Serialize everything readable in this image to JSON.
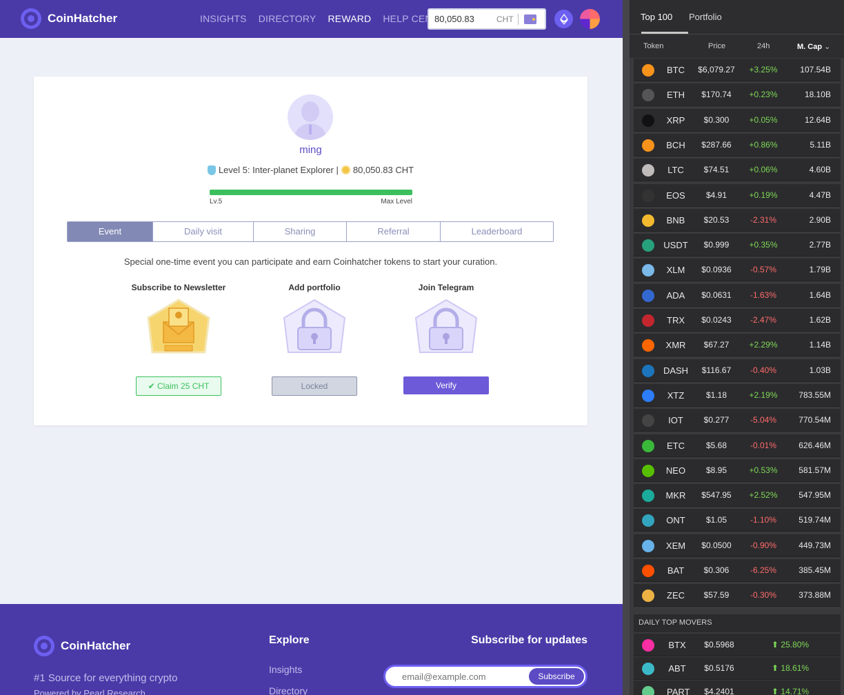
{
  "header": {
    "logo": "CoinHatcher",
    "nav": [
      "INSIGHTS",
      "DIRECTORY",
      "REWARD",
      "HELP CENTER"
    ],
    "active_nav": "REWARD",
    "balance": "80,050.83",
    "balance_unit": "CHT"
  },
  "profile": {
    "username": "ming",
    "level_text": "Level 5: Inter-planet Explorer |",
    "balance_text": "80,050.83 CHT",
    "progress": 1.0,
    "lv_left": "Lv.5",
    "lv_right": "Max Level"
  },
  "tabs": [
    "Event",
    "Daily visit",
    "Sharing",
    "Referral",
    "Leaderboard"
  ],
  "event": {
    "description": "Special one-time event you can participate and earn Coinhatcher tokens to start your curation.",
    "rewards": [
      {
        "title": "Subscribe to Newsletter",
        "button": "✔ Claim 25 CHT",
        "state": "claim"
      },
      {
        "title": "Add portfolio",
        "button": "Locked",
        "state": "locked"
      },
      {
        "title": "Join Telegram",
        "button": "Verify",
        "state": "verify"
      }
    ]
  },
  "footer": {
    "logo": "CoinHatcher",
    "tagline": "#1 Source for everything crypto",
    "powered": "Powered by Pearl Research",
    "explore_title": "Explore",
    "links": [
      "Insights",
      "Directory"
    ],
    "subscribe_title": "Subscribe for updates",
    "email_placeholder": "email@example.com",
    "subscribe_button": "Subscribe"
  },
  "panel": {
    "tabs": [
      "Top 100",
      "Portfolio"
    ],
    "columns": [
      "Token",
      "Price",
      "24h",
      "M. Cap"
    ],
    "tokens": [
      {
        "sym": "BTC",
        "price": "$6,079.27",
        "chg": "+3.25%",
        "cap": "107.54B",
        "color": "#f7931a"
      },
      {
        "sym": "ETH",
        "price": "$170.74",
        "chg": "+0.23%",
        "cap": "18.10B",
        "color": "#555555"
      },
      {
        "sym": "XRP",
        "price": "$0.300",
        "chg": "+0.05%",
        "cap": "12.64B",
        "color": "#111111"
      },
      {
        "sym": "BCH",
        "price": "$287.66",
        "chg": "+0.86%",
        "cap": "5.11B",
        "color": "#f7931a"
      },
      {
        "sym": "LTC",
        "price": "$74.51",
        "chg": "+0.06%",
        "cap": "4.60B",
        "color": "#bfbbbb"
      },
      {
        "sym": "EOS",
        "price": "$4.91",
        "chg": "+0.19%",
        "cap": "4.47B",
        "color": "#333333"
      },
      {
        "sym": "BNB",
        "price": "$20.53",
        "chg": "-2.31%",
        "cap": "2.90B",
        "color": "#f3ba2f"
      },
      {
        "sym": "USDT",
        "price": "$0.999",
        "chg": "+0.35%",
        "cap": "2.77B",
        "color": "#26a17b"
      },
      {
        "sym": "XLM",
        "price": "$0.0936",
        "chg": "-0.57%",
        "cap": "1.79B",
        "color": "#7ab8e8"
      },
      {
        "sym": "ADA",
        "price": "$0.0631",
        "chg": "-1.63%",
        "cap": "1.64B",
        "color": "#3468d1"
      },
      {
        "sym": "TRX",
        "price": "$0.0243",
        "chg": "-2.47%",
        "cap": "1.62B",
        "color": "#c4262e"
      },
      {
        "sym": "XMR",
        "price": "$67.27",
        "chg": "+2.29%",
        "cap": "1.14B",
        "color": "#ff6600"
      },
      {
        "sym": "DASH",
        "price": "$116.67",
        "chg": "-0.40%",
        "cap": "1.03B",
        "color": "#1c75bc"
      },
      {
        "sym": "XTZ",
        "price": "$1.18",
        "chg": "+2.19%",
        "cap": "783.55M",
        "color": "#2c7df7"
      },
      {
        "sym": "IOT",
        "price": "$0.277",
        "chg": "-5.04%",
        "cap": "770.54M",
        "color": "#444444"
      },
      {
        "sym": "ETC",
        "price": "$5.68",
        "chg": "-0.01%",
        "cap": "626.46M",
        "color": "#3ab83a"
      },
      {
        "sym": "NEO",
        "price": "$8.95",
        "chg": "+0.53%",
        "cap": "581.57M",
        "color": "#58bf00"
      },
      {
        "sym": "MKR",
        "price": "$547.95",
        "chg": "+2.52%",
        "cap": "547.95M",
        "color": "#1aab9b"
      },
      {
        "sym": "ONT",
        "price": "$1.05",
        "chg": "-1.10%",
        "cap": "519.74M",
        "color": "#32a4be"
      },
      {
        "sym": "XEM",
        "price": "$0.0500",
        "chg": "-0.90%",
        "cap": "449.73M",
        "color": "#67b2e8"
      },
      {
        "sym": "BAT",
        "price": "$0.306",
        "chg": "-6.25%",
        "cap": "385.45M",
        "color": "#ff5000"
      },
      {
        "sym": "ZEC",
        "price": "$57.59",
        "chg": "-0.30%",
        "cap": "373.88M",
        "color": "#ecb244"
      }
    ],
    "movers_title": "DAILY TOP MOVERS",
    "movers": [
      {
        "sym": "BTX",
        "price": "$0.5968",
        "chg": "25.80%",
        "color": "#fb2ea3"
      },
      {
        "sym": "ABT",
        "price": "$0.5176",
        "chg": "18.61%",
        "color": "#3cb9c8"
      },
      {
        "sym": "PART",
        "price": "$4.2401",
        "chg": "14.71%",
        "color": "#65cb8d"
      }
    ]
  }
}
